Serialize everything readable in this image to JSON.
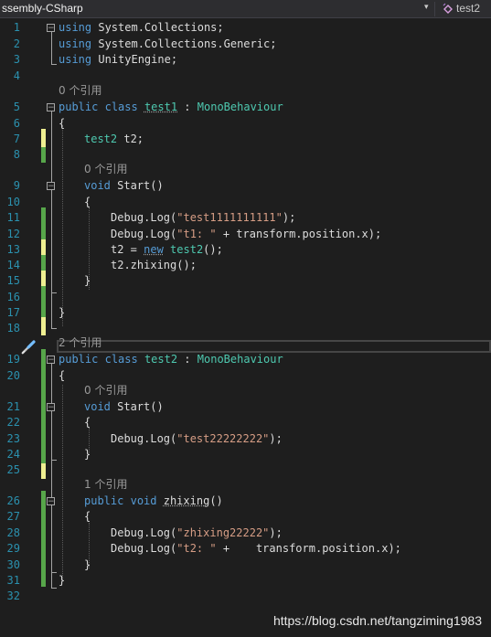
{
  "toolbar": {
    "project": "ssembly-CSharp",
    "member": "test2",
    "dropdown_arrow": "▾",
    "member_icon": "class-member-icon"
  },
  "lens": {
    "refs0": "0 个引用",
    "refs2": "2 个引用",
    "refs1": "1 个引用"
  },
  "line_numbers": [
    "1",
    "2",
    "3",
    "4",
    "5",
    "6",
    "7",
    "8",
    "9",
    "10",
    "11",
    "12",
    "13",
    "14",
    "15",
    "16",
    "17",
    "18",
    "19",
    "20",
    "21",
    "22",
    "23",
    "24",
    "25",
    "26",
    "27",
    "28",
    "29",
    "30",
    "31",
    "32"
  ],
  "code": {
    "using": "using",
    "ns1": "System.Collections;",
    "ns2": "System.Collections.Generic;",
    "ns3": "UnityEngine;",
    "public": "public",
    "class": "class",
    "colon": " : ",
    "test1": "test1",
    "test2": "test2",
    "mono": "MonoBehaviour",
    "open_brace": "{",
    "close_brace": "}",
    "field_name": " t2;",
    "void": "void",
    "start_call": " Start()",
    "debug_log": "Debug.Log(",
    "str_t1long": "\"test1111111111\"",
    "str_t1": "\"t1: \"",
    "plus_t1": " + transform.position.x);",
    "end_call": ");",
    "t2_assign": "t2 = ",
    "new": "new",
    "new_tail": "();",
    "zhixing_call": "t2.zhixing();",
    "str_test2": "\"test22222222\"",
    "zhixing": "zhixing",
    "parens": "()",
    "str_zhixing": "\"zhixing22222\"",
    "str_t2": "\"t2: \"",
    "plus_t2": " +    transform.position.x);"
  },
  "watermark": "https://blog.csdn.net/tangziming1983",
  "colors": {
    "background": "#1e1e1e",
    "keyword": "#569cd6",
    "type": "#4ec9b0",
    "string": "#d69d85",
    "line_number": "#2b91af",
    "saved_change": "#57a64a",
    "unsaved_change": "#efef91"
  },
  "icons": [
    "chevron-down-icon",
    "class-member-icon",
    "paintbrush-icon"
  ]
}
